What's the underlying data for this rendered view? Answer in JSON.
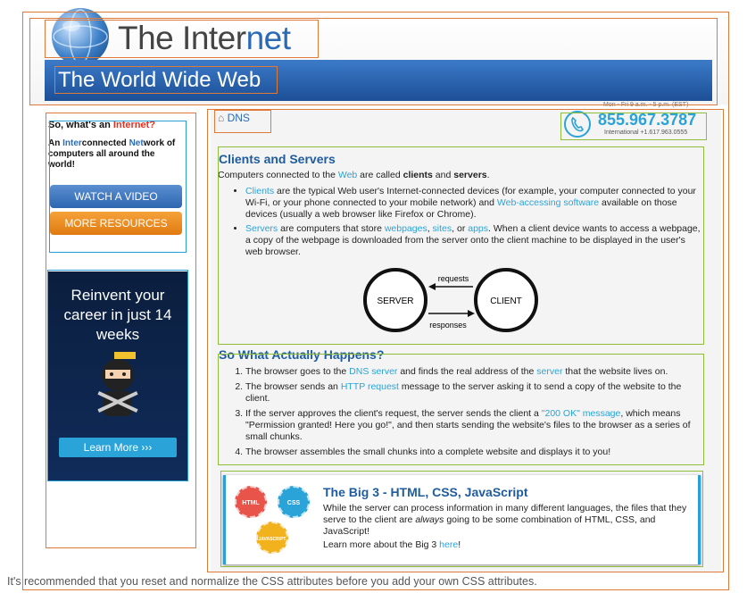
{
  "header": {
    "logo_prefix": "The Inter",
    "logo_suffix": "net",
    "banner": "The World Wide Web"
  },
  "sidebar": {
    "title_prefix": "So, what's an ",
    "title_red": "Internet?",
    "desc_a": "An ",
    "desc_b1": "Inter",
    "desc_c": "connected ",
    "desc_b2": "Net",
    "desc_d": "work of computers all around the world!",
    "btn_video": "WATCH A VIDEO",
    "btn_resources": "MORE RESOURCES"
  },
  "ad": {
    "headline": "Reinvent your career in just 14 weeks",
    "button": "Learn More ›››"
  },
  "breadcrumb": "DNS",
  "phone": {
    "hours": "Mon - Fri 9 a.m. - 5 p.m. (EST)",
    "number": "855.967.3787",
    "intl": "International +1.617.963.0555"
  },
  "clients": {
    "heading": "Clients and Servers",
    "intro_a": "Computers connected to the ",
    "intro_web": "Web",
    "intro_b": " are called ",
    "intro_clients": "clients",
    "intro_and": " and ",
    "intro_servers": "servers",
    "intro_end": ".",
    "b1_link": "Clients",
    "b1_a": " are the typical Web user's Internet-connected devices (for example, your computer connected to your Wi-Fi, or your phone connected to your mobile network) and ",
    "b1_link2": "Web-accessing software",
    "b1_b": " available on those devices (usually a web browser like Firefox or Chrome).",
    "b2_link": "Servers",
    "b2_a": " are computers that store ",
    "b2_l1": "webpages",
    "b2_sep1": ", ",
    "b2_l2": "sites",
    "b2_sep2": ", or ",
    "b2_l3": "apps",
    "b2_b": ". When a client device wants to access a webpage, a copy of the webpage is downloaded from the server onto the client machine to be displayed in the user's web browser."
  },
  "diagram": {
    "server": "SERVER",
    "client": "CLIENT",
    "requests": "requests",
    "responses": "responses"
  },
  "happens": {
    "heading": "So What Actually Happens?",
    "s1_a": "The browser goes to the ",
    "s1_l1": "DNS server",
    "s1_b": " and finds the real address of the ",
    "s1_l2": "server",
    "s1_c": " that the website lives on.",
    "s2_a": "The browser sends an ",
    "s2_l1": "HTTP request",
    "s2_b": " message to the server asking it to send a copy of the website to the client.",
    "s3_a": "If the server approves the client's request, the server sends the client a ",
    "s3_l1": "\"200 OK\" message",
    "s3_b": ", which means \"Permission granted! Here you go!\", and then starts sending the website's files to the browser as a series of small chunks.",
    "s4": "The browser assembles the small chunks into a complete website and displays it to you!"
  },
  "big3": {
    "heading": "The Big 3 - HTML, CSS, JavaScript",
    "text_a": "While the server can process information in many different languages, the files that they serve to the client are ",
    "text_em": "always",
    "text_b": " going to be some combination of HTML, CSS, and JavaScript!",
    "more_a": "Learn more about the Big 3 ",
    "more_link": "here",
    "more_b": "!",
    "icon_html": "HTML",
    "icon_css": "CSS",
    "icon_js": "JAVASCRIPT"
  },
  "footer": "It's recommended that you reset and normalize the CSS attributes before you add your own CSS attributes.",
  "colors": {
    "accent": "#2aa3d8",
    "brand": "#1f5c9e",
    "overlay_orange": "#e07a3a",
    "overlay_green": "#8fbf3a",
    "overlay_blue": "#2a9fd6"
  }
}
